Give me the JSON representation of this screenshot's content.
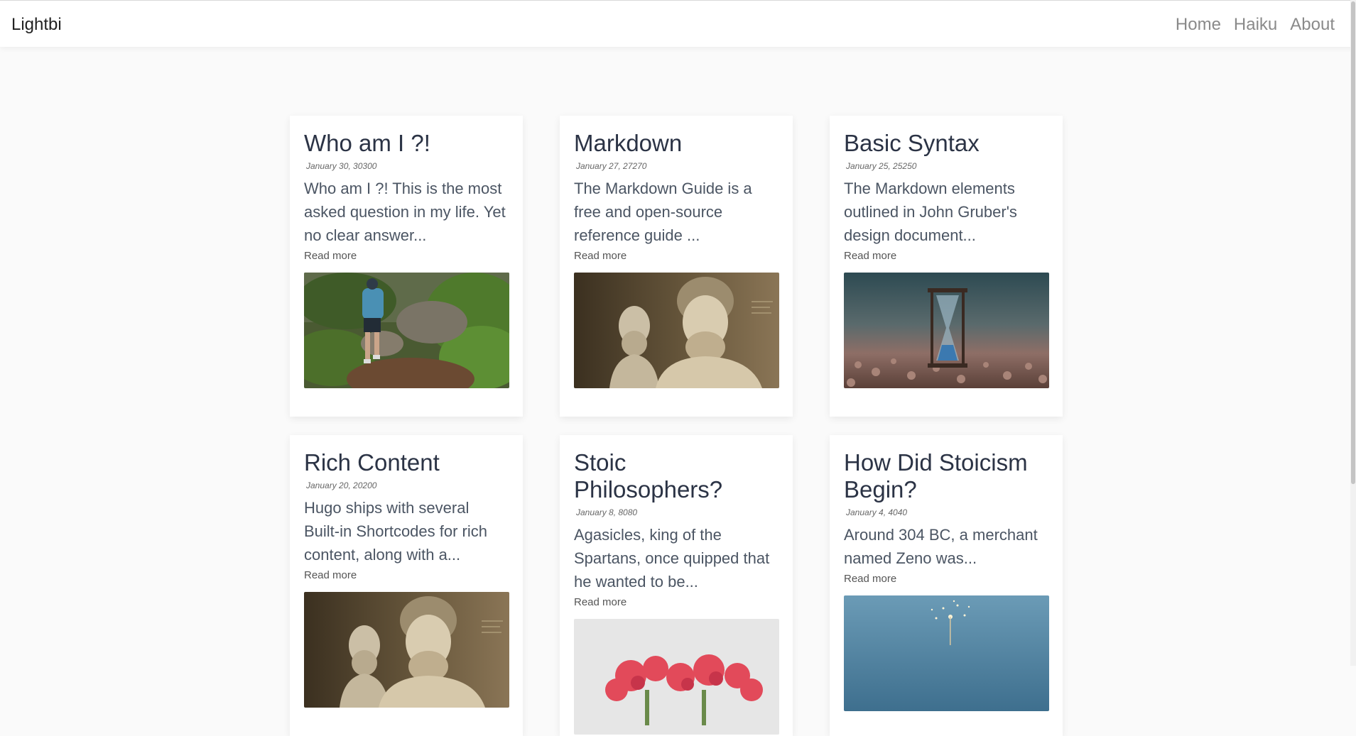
{
  "nav": {
    "brand": "Lightbi",
    "links": [
      {
        "label": "Home"
      },
      {
        "label": "Haiku"
      },
      {
        "label": "About"
      }
    ]
  },
  "posts": [
    {
      "title": "Who am I ?!",
      "date": "January 30, 30300",
      "summary": "Who am I ?! This is the most asked question in my life. Yet no clear answer...",
      "read_more": "Read more",
      "image": "hiker-in-forest"
    },
    {
      "title": "Markdown",
      "date": "January 27, 27270",
      "summary": "The Markdown Guide is a free and open-source reference guide ...",
      "read_more": "Read more",
      "image": "marble-busts"
    },
    {
      "title": "Basic Syntax",
      "date": "January 25, 25250",
      "summary": "The Markdown elements outlined in John Gruber's design document...",
      "read_more": "Read more",
      "image": "hourglass-on-pebbles"
    },
    {
      "title": "Rich Content",
      "date": "January 20, 20200",
      "summary": "Hugo ships with several Built-in Shortcodes for rich content, along with a...",
      "read_more": "Read more",
      "image": "marble-busts"
    },
    {
      "title": "Stoic Philosophers?",
      "date": "January 8, 8080",
      "summary": "Agasicles, king of the Spartans, once quipped that he wanted to be...",
      "read_more": "Read more",
      "image": "red-flowers"
    },
    {
      "title": "How Did Stoicism Begin?",
      "date": "January 4, 4040",
      "summary": "Around 304 BC, a merchant named Zeno was...",
      "read_more": "Read more",
      "image": "sparkler-at-sea"
    }
  ]
}
